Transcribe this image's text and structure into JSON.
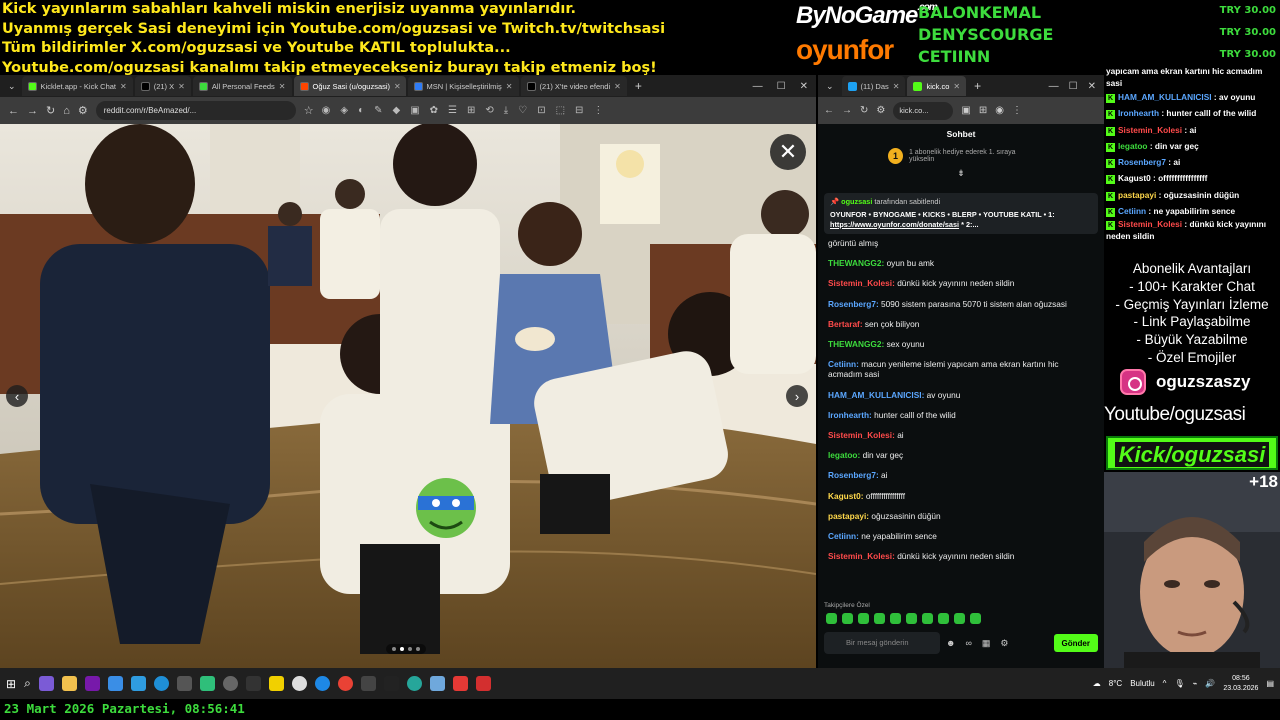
{
  "overlay": {
    "top_lines": [
      "Kick yayınlarım sabahları kahveli miskin enerjisiz uyanma yayınlarıdır.",
      "Uyanmış gerçek Sasi deneyimi için Youtube.com/oguzsasi ve Twitch.tv/twitchsasi",
      "Tüm bildirimler X.com/oguzsasi ve Youtube KATIL toplulukta...",
      "Youtube.com/oguzsasi kanalımı takip etmeyecekseniz burayı takip etmeniz boş!"
    ],
    "sponsors": {
      "bynogame": "ByNoGame",
      "bynogame_suffix": ".com",
      "oyunfor": "oyunfor"
    },
    "donors": [
      "BALONKEMAL",
      "DENYSCOURGE",
      "CETIINN"
    ],
    "tips": [
      "TRY 30.00",
      "TRY 30.00",
      "TRY 30.00"
    ],
    "perks": [
      "Abonelik Avantajları",
      "- 100+ Karakter Chat",
      "- Geçmiş Yayınları İzleme",
      "- Link Paylaşabilme",
      "- Büyük Yazabilme",
      "- Özel Emojiler"
    ],
    "instagram": "oguzszaszy",
    "youtube": "Youtube/oguzsasi",
    "kick": "Kick/oguzsasi",
    "age": "+18",
    "bottom_datetime": "23 Mart 2026 Pazartesi, 08:56:41",
    "overlay_chat": [
      {
        "user": "",
        "text": "yapıcam ama ekran kartını hic acmadım sasi",
        "color": "#ffffff",
        "icon": false,
        "wrap": true
      },
      {
        "user": "HAM_AM_KULLANICISI",
        "text": "av oyunu",
        "color": "#5ba7ff",
        "icon": true
      },
      {
        "user": "Ironhearth",
        "text": "hunter calll of the wilid",
        "color": "#5ba7ff",
        "icon": true
      },
      {
        "user": "Sistemin_Kolesi",
        "text": "ai",
        "color": "#ff4b4b",
        "icon": true
      },
      {
        "user": "legatoo",
        "text": "din var geç",
        "color": "#3ddc3d",
        "icon": true
      },
      {
        "user": "Rosenberg7",
        "text": "ai",
        "color": "#5ba7ff",
        "icon": true
      },
      {
        "user": "Kagust0",
        "text": "offffffffffffffff",
        "color": "#ffffff",
        "icon": true
      },
      {
        "user": "pastapayi",
        "text": "oğuzsasinin düğün",
        "color": "#ffd84b",
        "icon": true
      },
      {
        "user": "Cetiinn",
        "text": "ne yapabilirim sence",
        "color": "#5ba7ff",
        "icon": true
      },
      {
        "user": "Sistemin_Kolesi",
        "text": "dünkü kick yayınını neden sildin",
        "color": "#ff4b4b",
        "icon": true,
        "wrap": true
      }
    ]
  },
  "browser1": {
    "tabs": [
      {
        "label": "Kicklet.app - Kick Chat",
        "color": "#53fc18",
        "active": false
      },
      {
        "label": "(21) X",
        "color": "#000000",
        "active": false
      },
      {
        "label": "All Personal Feeds",
        "color": "#3ddc3d",
        "active": false
      },
      {
        "label": "Oğuz Sasi (u/oguzsasi)",
        "color": "#ff4500",
        "active": true
      },
      {
        "label": "MSN | Kişiselleştirilmiş",
        "color": "#2f7cf6",
        "active": false
      },
      {
        "label": "(21) X'te video efendi",
        "color": "#000000",
        "active": false
      }
    ],
    "url": "reddit.com/r/BeAmazed/..."
  },
  "browser2": {
    "tabs": [
      {
        "label": "(11) Das",
        "color": "#1da1f2"
      },
      {
        "label": "kick.co",
        "color": "#53fc18"
      }
    ],
    "url": "kick.co...",
    "chat_title": "Sohbet",
    "sub_goal_badge": "1",
    "sub_goal_text": "1 abonelik hediye ederek 1. sıraya yükselin",
    "pinned_by_user": "oguzsasi",
    "pinned_by_suffix": "tarafından sabitlendi",
    "pinned_text": "OYUNFOR • BYNOGAME • KICKS • BLERP • YOUTUBE KATIL • 1:",
    "pinned_link": "https://www.oyunfor.com/donate/sasi",
    "pinned_link_suffix": "* 2:...",
    "messages": [
      {
        "user": "",
        "text": "görüntü almış",
        "color": "#ffffff"
      },
      {
        "user": "THEWANGG2",
        "text": "oyun bu amk",
        "color": "#3ddc3d"
      },
      {
        "user": "Sistemin_Kolesi",
        "text": "dünkü kick yayınını neden sildin",
        "color": "#ff4b4b"
      },
      {
        "user": "Rosenberg7",
        "text": "5090 sistem parasına 5070 ti sistem alan oğuzsasi",
        "color": "#5ba7ff"
      },
      {
        "user": "Bertaraf",
        "text": "sen çok biliyon",
        "color": "#ff4b4b"
      },
      {
        "user": "THEWANGG2",
        "text": "sex oyunu",
        "color": "#3ddc3d"
      },
      {
        "user": "Cetiinn",
        "text": "macun yenileme islemi yapıcam ama ekran kartını hic acmadım sasi",
        "color": "#5ba7ff"
      },
      {
        "user": "HAM_AM_KULLANICISI",
        "text": "av oyunu",
        "color": "#5ba7ff"
      },
      {
        "user": "Ironhearth",
        "text": "hunter calll of the wilid",
        "color": "#5ba7ff"
      },
      {
        "user": "Sistemin_Kolesi",
        "text": "ai",
        "color": "#ff4b4b"
      },
      {
        "user": "legatoo",
        "text": "din var geç",
        "color": "#3ddc3d"
      },
      {
        "user": "Rosenberg7",
        "text": "ai",
        "color": "#5ba7ff"
      },
      {
        "user": "Kagust0",
        "text": "offffffffffffffff",
        "color": "#ffd84b"
      },
      {
        "user": "pastapayi",
        "text": "oğuzsasinin düğün",
        "color": "#ffd84b"
      },
      {
        "user": "Cetiinn",
        "text": "ne yapabilirim sence",
        "color": "#5ba7ff"
      },
      {
        "user": "Sistemin_Kolesi",
        "text": "dünkü kick yayınını neden sildin",
        "color": "#ff4b4b"
      }
    ],
    "follower_only": "Takipçilere Özel",
    "input_placeholder": "Bir mesaj gönderin",
    "send_label": "Gönder"
  },
  "taskbar": {
    "weather": "8°C",
    "weather_label": "Bulutlu",
    "time": "08:56",
    "date": "23.03.2026"
  }
}
